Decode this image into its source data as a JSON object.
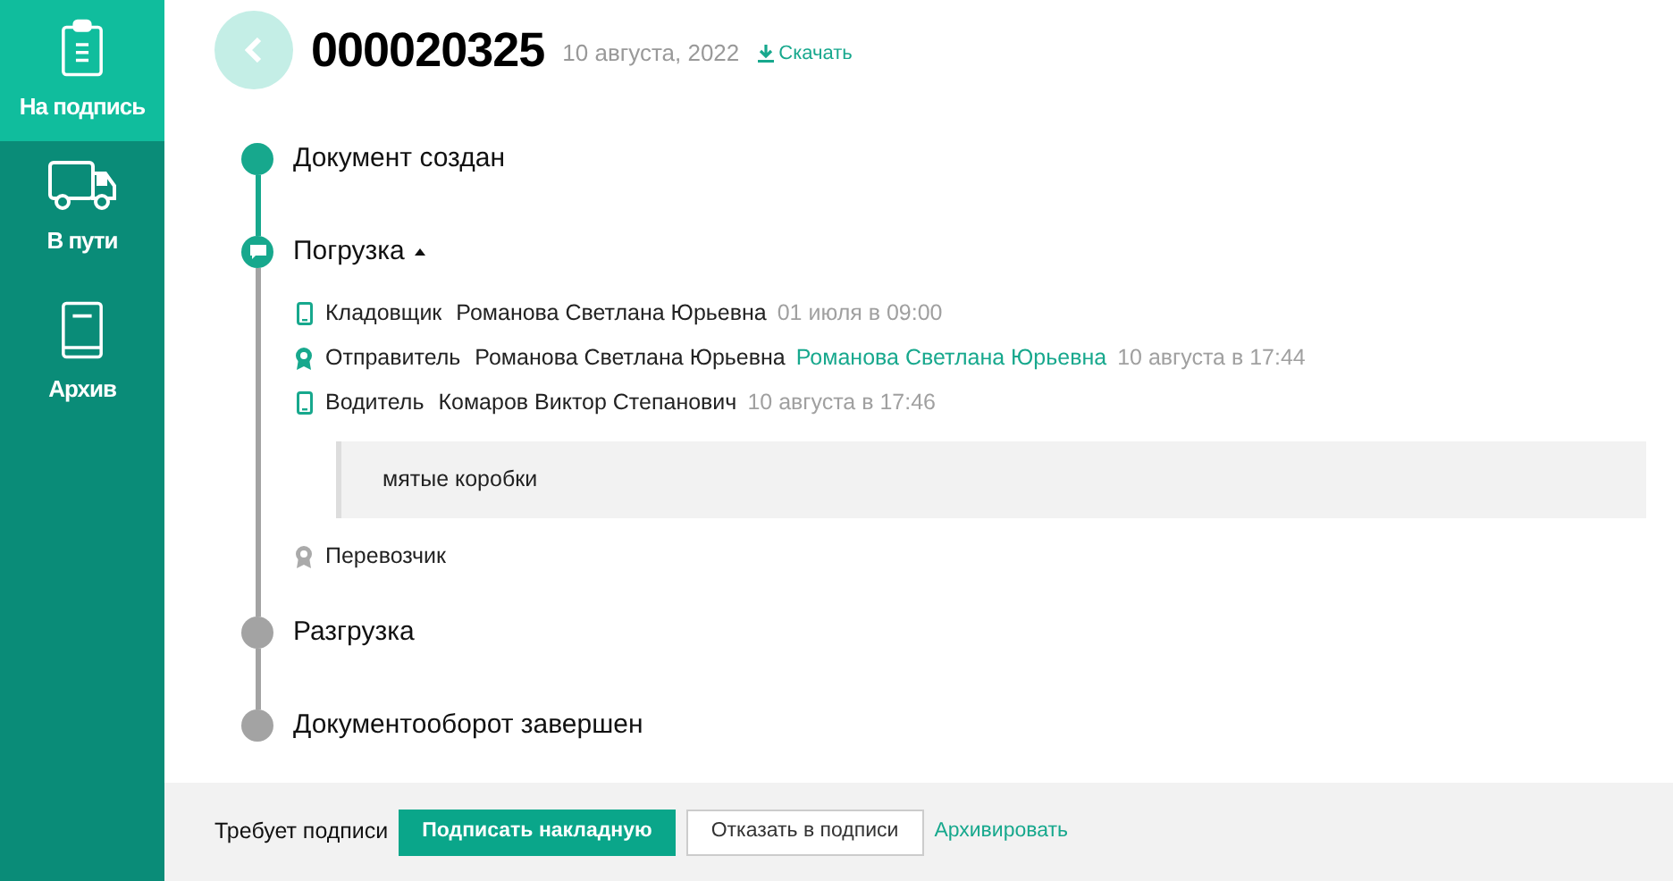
{
  "sidebar": {
    "items": [
      {
        "kind": "clipboard",
        "label": "На подпись",
        "selected": true
      },
      {
        "kind": "truck",
        "label": "В пути",
        "selected": false
      },
      {
        "kind": "book",
        "label": "Архив",
        "selected": false
      }
    ]
  },
  "header": {
    "number": "000020325",
    "date": "10 августа, 2022",
    "download": "Скачать"
  },
  "stages": [
    {
      "title": "Документ создан",
      "kind": "done"
    },
    {
      "title": "Погрузка",
      "kind": "active",
      "expanded": true,
      "participants": [
        {
          "kind": "phone",
          "done": true,
          "role": "Кладовщик",
          "name": "Романова Светлана Юрьевна",
          "time": "01 июля в 09:00"
        },
        {
          "kind": "seal",
          "done": true,
          "role": "Отправитель",
          "name": "Романова Светлана Юрьевна",
          "signer": "Романова Светлана Юрьевна",
          "time": "10 августа в 17:44"
        },
        {
          "kind": "phone",
          "done": true,
          "role": "Водитель",
          "name": "Комаров Виктор Степанович",
          "time": "10 августа в 17:46",
          "comment": "мятые коробки"
        },
        {
          "kind": "seal",
          "done": false,
          "role": "Перевозчик"
        }
      ]
    },
    {
      "title": "Разгрузка",
      "kind": "pending"
    },
    {
      "title": "Документооборот завершен",
      "kind": "pending"
    }
  ],
  "footer": {
    "note": "Требует подписи",
    "sign": "Подписать накладную",
    "refuse": "Отказать в подписи",
    "archive": "Архивировать"
  }
}
